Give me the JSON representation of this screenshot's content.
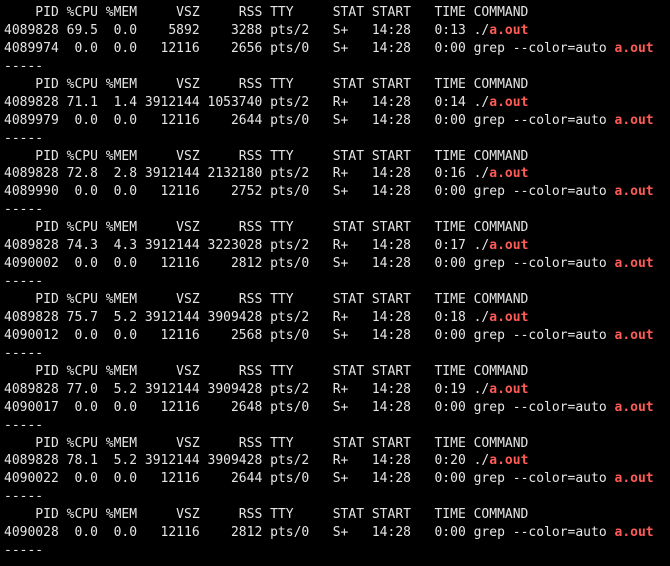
{
  "columns": {
    "pid": "PID",
    "cpu": "%CPU",
    "mem": "%MEM",
    "vsz": "VSZ",
    "rss": "RSS",
    "tty": "TTY",
    "stat": "STAT",
    "start": "START",
    "time": "TIME",
    "command": "COMMAND"
  },
  "separator": "-----",
  "cmd": {
    "run_prefix": "./",
    "run_target": "a.out",
    "grep_prefix": "grep --color=auto ",
    "grep_target": "a.out"
  },
  "blocks": [
    {
      "rows": [
        {
          "pid": "4089828",
          "cpu": "69.5",
          "mem": "0.0",
          "vsz": "5892",
          "rss": "3288",
          "tty": "pts/2",
          "stat": "S+",
          "start": "14:28",
          "time": "0:13",
          "cmd": "run"
        },
        {
          "pid": "4089974",
          "cpu": "0.0",
          "mem": "0.0",
          "vsz": "12116",
          "rss": "2656",
          "tty": "pts/0",
          "stat": "S+",
          "start": "14:28",
          "time": "0:00",
          "cmd": "grep"
        }
      ]
    },
    {
      "rows": [
        {
          "pid": "4089828",
          "cpu": "71.1",
          "mem": "1.4",
          "vsz": "3912144",
          "rss": "1053740",
          "tty": "pts/2",
          "stat": "R+",
          "start": "14:28",
          "time": "0:14",
          "cmd": "run"
        },
        {
          "pid": "4089979",
          "cpu": "0.0",
          "mem": "0.0",
          "vsz": "12116",
          "rss": "2644",
          "tty": "pts/0",
          "stat": "S+",
          "start": "14:28",
          "time": "0:00",
          "cmd": "grep"
        }
      ]
    },
    {
      "rows": [
        {
          "pid": "4089828",
          "cpu": "72.8",
          "mem": "2.8",
          "vsz": "3912144",
          "rss": "2132180",
          "tty": "pts/2",
          "stat": "R+",
          "start": "14:28",
          "time": "0:16",
          "cmd": "run"
        },
        {
          "pid": "4089990",
          "cpu": "0.0",
          "mem": "0.0",
          "vsz": "12116",
          "rss": "2752",
          "tty": "pts/0",
          "stat": "S+",
          "start": "14:28",
          "time": "0:00",
          "cmd": "grep"
        }
      ]
    },
    {
      "rows": [
        {
          "pid": "4089828",
          "cpu": "74.3",
          "mem": "4.3",
          "vsz": "3912144",
          "rss": "3223028",
          "tty": "pts/2",
          "stat": "R+",
          "start": "14:28",
          "time": "0:17",
          "cmd": "run"
        },
        {
          "pid": "4090002",
          "cpu": "0.0",
          "mem": "0.0",
          "vsz": "12116",
          "rss": "2812",
          "tty": "pts/0",
          "stat": "S+",
          "start": "14:28",
          "time": "0:00",
          "cmd": "grep"
        }
      ]
    },
    {
      "rows": [
        {
          "pid": "4089828",
          "cpu": "75.7",
          "mem": "5.2",
          "vsz": "3912144",
          "rss": "3909428",
          "tty": "pts/2",
          "stat": "R+",
          "start": "14:28",
          "time": "0:18",
          "cmd": "run"
        },
        {
          "pid": "4090012",
          "cpu": "0.0",
          "mem": "0.0",
          "vsz": "12116",
          "rss": "2568",
          "tty": "pts/0",
          "stat": "S+",
          "start": "14:28",
          "time": "0:00",
          "cmd": "grep"
        }
      ]
    },
    {
      "rows": [
        {
          "pid": "4089828",
          "cpu": "77.0",
          "mem": "5.2",
          "vsz": "3912144",
          "rss": "3909428",
          "tty": "pts/2",
          "stat": "R+",
          "start": "14:28",
          "time": "0:19",
          "cmd": "run"
        },
        {
          "pid": "4090017",
          "cpu": "0.0",
          "mem": "0.0",
          "vsz": "12116",
          "rss": "2648",
          "tty": "pts/0",
          "stat": "S+",
          "start": "14:28",
          "time": "0:00",
          "cmd": "grep"
        }
      ]
    },
    {
      "rows": [
        {
          "pid": "4089828",
          "cpu": "78.1",
          "mem": "5.2",
          "vsz": "3912144",
          "rss": "3909428",
          "tty": "pts/2",
          "stat": "R+",
          "start": "14:28",
          "time": "0:20",
          "cmd": "run"
        },
        {
          "pid": "4090022",
          "cpu": "0.0",
          "mem": "0.0",
          "vsz": "12116",
          "rss": "2644",
          "tty": "pts/0",
          "stat": "S+",
          "start": "14:28",
          "time": "0:00",
          "cmd": "grep"
        }
      ]
    },
    {
      "rows": [
        {
          "pid": "4090028",
          "cpu": "0.0",
          "mem": "0.0",
          "vsz": "12116",
          "rss": "2812",
          "tty": "pts/0",
          "stat": "S+",
          "start": "14:28",
          "time": "0:00",
          "cmd": "grep"
        }
      ]
    }
  ]
}
